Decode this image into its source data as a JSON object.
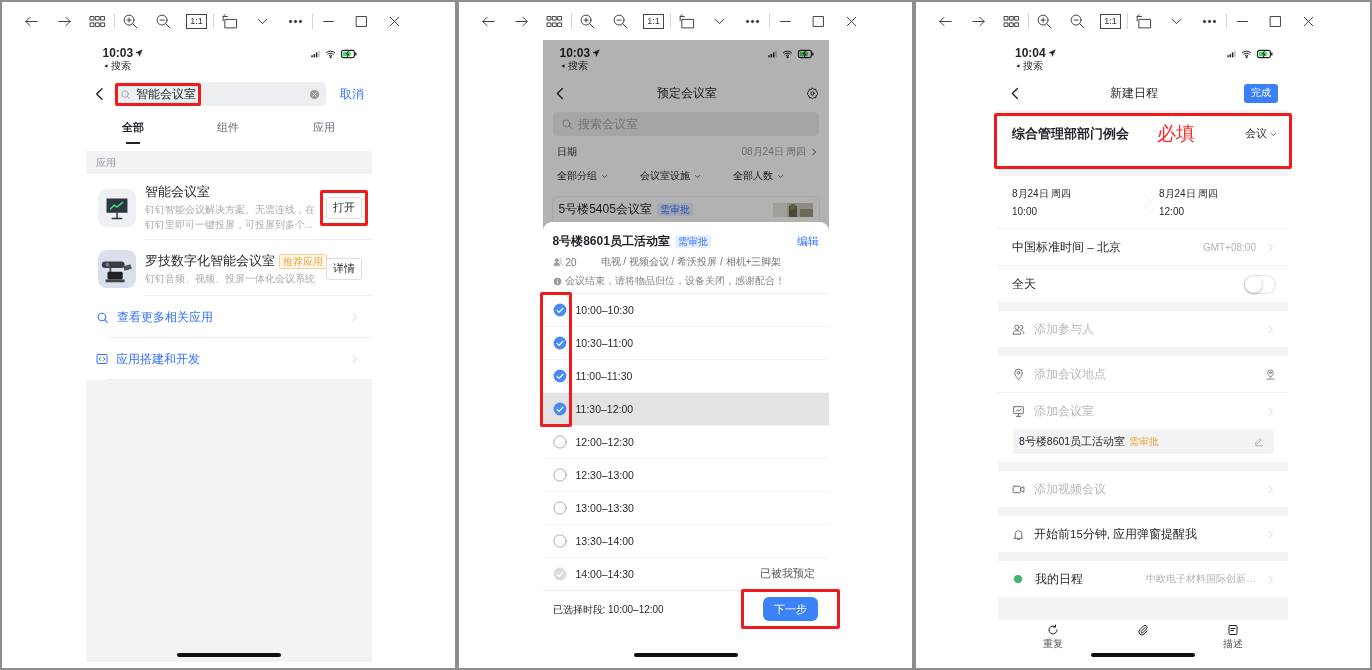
{
  "windows": [
    {
      "toolbar": {
        "actual_size_label": "1:1"
      },
      "screen": {
        "kind": "search",
        "status": {
          "time": "10:03",
          "back_app": "搜索"
        },
        "search": {
          "value": "智能会议室",
          "highlighted": true
        },
        "cancel": "取消",
        "tabs": [
          {
            "label": "全部",
            "selected": true
          },
          {
            "label": "组件",
            "selected": false
          },
          {
            "label": "应用",
            "selected": false
          }
        ],
        "section": "应用",
        "results": [
          {
            "kind": "icon",
            "title": "智能会议室",
            "description": "钉钉智能会议解决方案。无需连线，在钉钉里即可一键投屏，可投屏到多个...",
            "button": "打开",
            "button_highlighted": true
          },
          {
            "kind": "picture",
            "title": "罗技数字化智能会议室",
            "badge": "推荐应用",
            "description": "钉钉音频、视频、投屏一体化会议系统",
            "button": "详情",
            "button_highlighted": false
          }
        ],
        "links": [
          {
            "label": "查看更多相关应用"
          },
          {
            "label": "应用搭建和开发"
          }
        ]
      }
    },
    {
      "toolbar": {
        "actual_size_label": "1:1"
      },
      "screen": {
        "kind": "booking",
        "status": {
          "time": "10:03",
          "back_app": "搜索"
        },
        "title": "预定会议室",
        "search_placeholder": "搜索会议室",
        "date": {
          "label": "日期",
          "value": "08月24日 周四"
        },
        "filters": [
          "全部分组",
          "会议室设施",
          "全部人数"
        ],
        "behind_card": {
          "title": "5号楼5405会议室",
          "badge": "需审批"
        },
        "sheet": {
          "title": "8号楼8601员工活动室",
          "badge": "需审批",
          "edit": "编辑",
          "capacity": "20",
          "facilities": "电视 / 视频会议 / 希沃投屏 / 相机+三脚架",
          "notice": "会议结束，请将物品归位，设备关闭，感谢配合！",
          "highlight_selected": true,
          "slots": [
            {
              "time": "10:00–10:30",
              "selected": true,
              "pressed": false,
              "booked": false
            },
            {
              "time": "10:30–11:00",
              "selected": true,
              "pressed": false,
              "booked": false
            },
            {
              "time": "11:00–11:30",
              "selected": true,
              "pressed": false,
              "booked": false
            },
            {
              "time": "11:30–12:00",
              "selected": true,
              "pressed": true,
              "booked": false
            },
            {
              "time": "12:00–12:30",
              "selected": false,
              "pressed": false,
              "booked": false
            },
            {
              "time": "12:30–13:00",
              "selected": false,
              "pressed": false,
              "booked": false
            },
            {
              "time": "13:00–13:30",
              "selected": false,
              "pressed": false,
              "booked": false
            },
            {
              "time": "13:30–14:00",
              "selected": false,
              "pressed": false,
              "booked": false
            },
            {
              "time": "14:00–14:30",
              "selected": false,
              "pressed": false,
              "booked": true,
              "status": "已被我预定"
            }
          ],
          "summary": "已选择时段: 10:00–12:00",
          "next": "下一步",
          "next_highlighted": true
        }
      }
    },
    {
      "toolbar": {
        "actual_size_label": "1:1"
      },
      "screen": {
        "kind": "event",
        "status": {
          "time": "10:04",
          "back_app": "搜索"
        },
        "title": "新建日程",
        "done": "完成",
        "event_title": {
          "text": "综合管理部部门例会",
          "note": "必填",
          "type": "会议",
          "highlighted": true
        },
        "start": {
          "date": "8月24日 周四",
          "time": "10:00"
        },
        "end": {
          "date": "8月24日 周四",
          "time": "12:00"
        },
        "timezone": {
          "label": "中国标准时间 – 北京",
          "value": "GMT+08:00"
        },
        "all_day": {
          "label": "全天",
          "on": false
        },
        "groups": [
          [
            {
              "kind": "people",
              "label": "添加参与人",
              "placeholder": true
            }
          ],
          [
            {
              "kind": "location",
              "label": "添加会议地点",
              "placeholder": true
            },
            {
              "kind": "room",
              "label": "添加会议室",
              "placeholder": true
            },
            {
              "kind": "room-chip",
              "label": "8号楼8601员工活动室",
              "badge": "需审批"
            }
          ],
          [
            {
              "kind": "video",
              "label": "添加视频会议",
              "placeholder": true
            }
          ],
          [
            {
              "kind": "reminder",
              "label": "开始前15分钟, 应用弹窗提醒我",
              "placeholder": false
            }
          ],
          [
            {
              "kind": "calendar",
              "label": "我的日程",
              "color": "#3fb56b",
              "value": "中欧电子材料国际创新…"
            }
          ]
        ],
        "bottom_bar": [
          {
            "kind": "repeat",
            "label": "重复"
          },
          {
            "kind": "attach"
          },
          {
            "kind": "note",
            "label": "描述"
          }
        ]
      }
    }
  ]
}
